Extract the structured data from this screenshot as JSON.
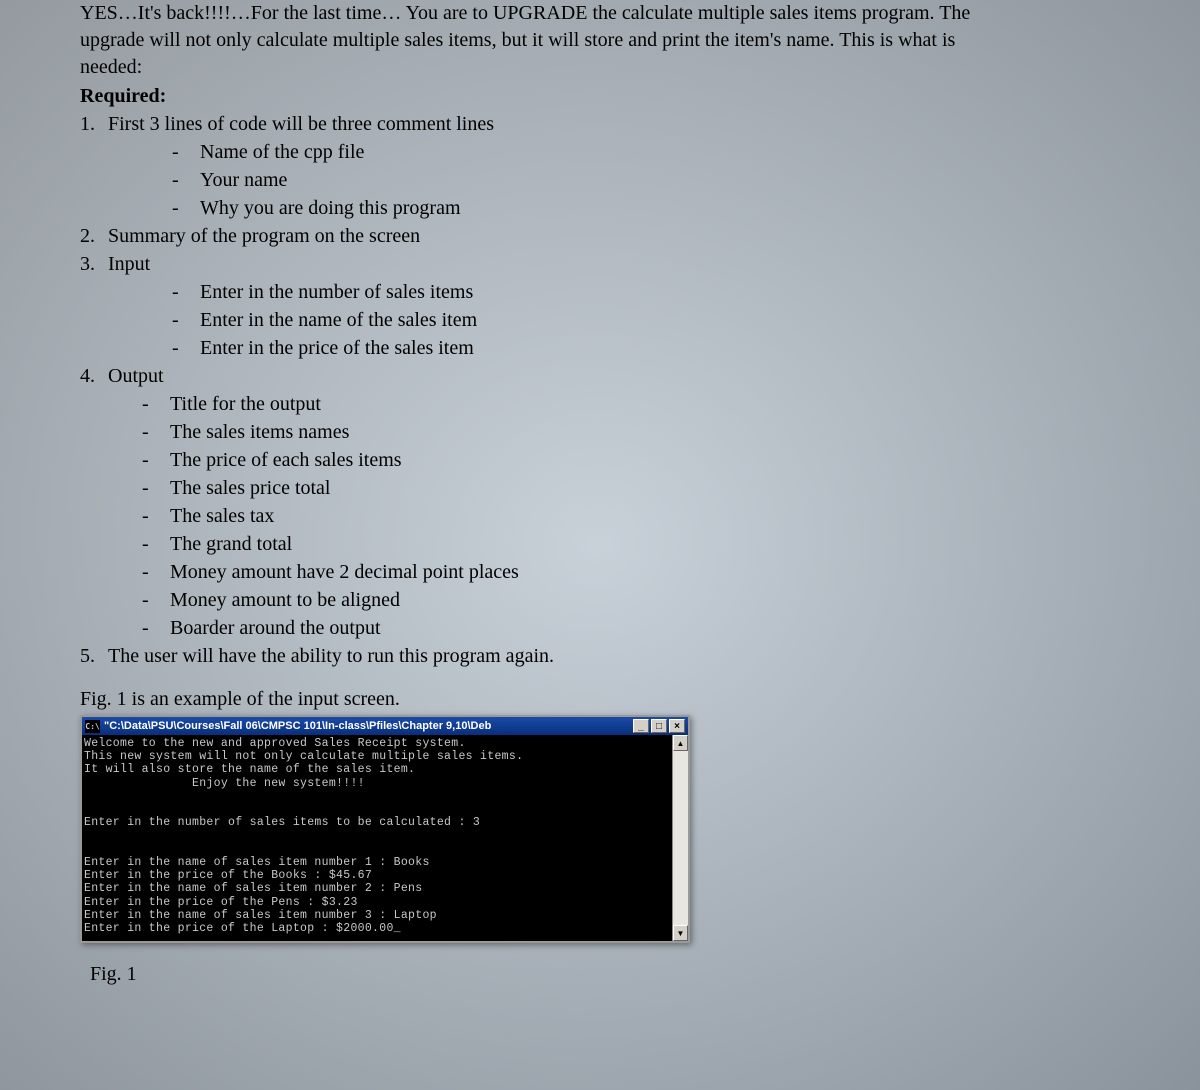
{
  "intro": {
    "line1_partial": "YES…It's back!!!!…For the last time… You are to UPGRADE the calculate multiple sales items program.  The",
    "line2": "upgrade will not only calculate multiple sales items, but it will store and print the item's name.  This is what is",
    "line3": "needed:"
  },
  "required_label": "Required:",
  "req1": {
    "num": "1.",
    "text": "First 3 lines of code will be three comment lines",
    "subs": [
      "Name of the cpp file",
      "Your name",
      "Why you are doing this program"
    ]
  },
  "req2": {
    "num": "2.",
    "text": "Summary of the program on the screen"
  },
  "req3": {
    "num": "3.",
    "text": "Input",
    "subs": [
      "Enter in the number of sales items",
      "Enter in the name of the sales item",
      "Enter in the price of the sales item"
    ]
  },
  "req4": {
    "num": "4.",
    "text": "Output",
    "subs": [
      "Title for the output",
      "The sales items names",
      "The price of each sales items",
      "The sales price total",
      "The sales tax",
      "The grand total",
      "Money amount have 2 decimal point places",
      "Money amount to be aligned",
      "Boarder around the output"
    ]
  },
  "req5": {
    "num": "5.",
    "text": "The user will have the ability to run this program again."
  },
  "fig_caption_top": "Fig. 1 is an example of the input screen.",
  "console": {
    "icon_text": "C:\\",
    "title": "\"C:\\Data\\PSU\\Courses\\Fall 06\\CMPSC 101\\In-class\\Pfiles\\Chapter 9,10\\Deb",
    "buttons": {
      "min": "_",
      "max": "□",
      "close": "×"
    },
    "body": "Welcome to the new and approved Sales Receipt system.\nThis new system will not only calculate multiple sales items.\nIt will also store the name of the sales item.\n               Enjoy the new system!!!!\n\n\nEnter in the number of sales items to be calculated : 3\n\n\nEnter in the name of sales item number 1 : Books\nEnter in the price of the Books : $45.67\nEnter in the name of sales item number 2 : Pens\nEnter in the price of the Pens : $3.23\nEnter in the name of sales item number 3 : Laptop\nEnter in the price of the Laptop : $2000.00_",
    "scroll_up": "▲",
    "scroll_down": "▼"
  },
  "fig_label": "Fig. 1"
}
